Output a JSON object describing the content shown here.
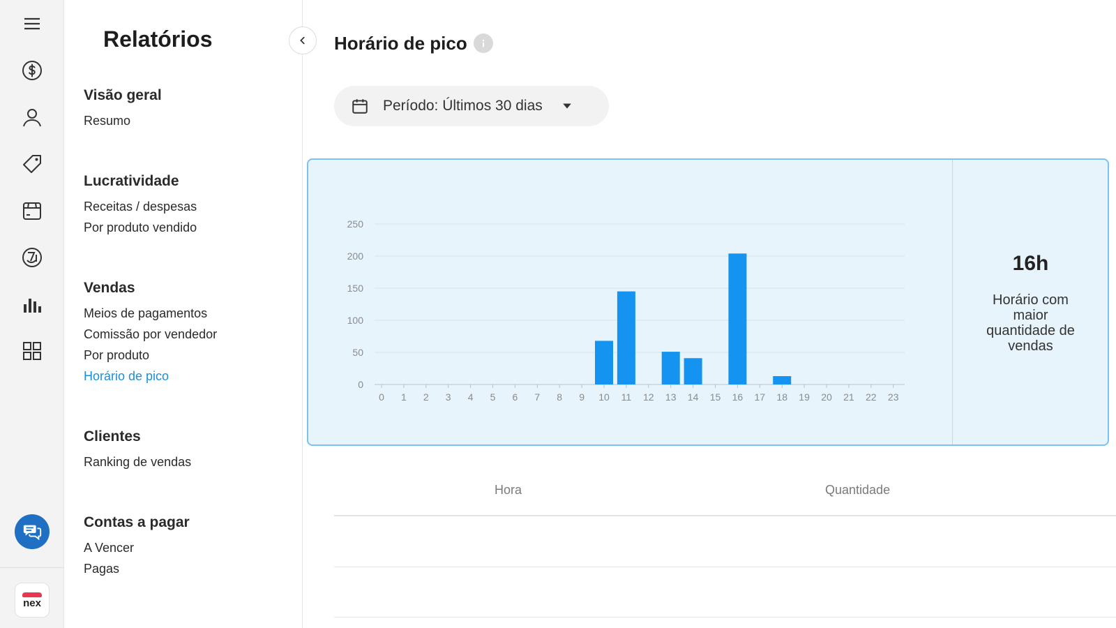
{
  "sidebar": {
    "title": "Relatórios",
    "sections": [
      {
        "title": "Visão geral",
        "items": [
          "Resumo"
        ]
      },
      {
        "title": "Lucratividade",
        "items": [
          "Receitas / despesas",
          "Por produto vendido"
        ]
      },
      {
        "title": "Vendas",
        "items": [
          "Meios de pagamentos",
          "Comissão por vendedor",
          "Por produto",
          "Horário de pico"
        ]
      },
      {
        "title": "Clientes",
        "items": [
          "Ranking de vendas"
        ]
      },
      {
        "title": "Contas a pagar",
        "items": [
          "A Vencer",
          "Pagas"
        ]
      }
    ],
    "active_item": "Horário de pico"
  },
  "rail": {
    "icons": [
      "menu-icon",
      "dollar-icon",
      "user-icon",
      "tag-icon",
      "box-icon",
      "dial-icon",
      "bar-chart-icon",
      "grid-icon"
    ],
    "chat_icon": "chat-icon",
    "logo_text": "nex"
  },
  "main": {
    "title": "Horário de pico",
    "period_label": "Período: Últimos 30 dias",
    "peak_value": "16h",
    "peak_label": "Horário com maior quantidade de vendas",
    "table_headers": [
      "Hora",
      "Quantidade"
    ]
  },
  "colors": {
    "accent": "#1a8fd6",
    "bar": "#1593f0",
    "card_bg": "#e8f4fc",
    "card_border": "#7cc2ee"
  },
  "chart_data": {
    "type": "bar",
    "categories": [
      "0",
      "1",
      "2",
      "3",
      "4",
      "5",
      "6",
      "7",
      "8",
      "9",
      "10",
      "11",
      "12",
      "13",
      "14",
      "15",
      "16",
      "17",
      "18",
      "19",
      "20",
      "21",
      "22",
      "23"
    ],
    "values": [
      0,
      0,
      0,
      0,
      0,
      0,
      0,
      0,
      0,
      0,
      68,
      145,
      0,
      51,
      41,
      0,
      204,
      0,
      13,
      0,
      0,
      0,
      0,
      0
    ],
    "yticks": [
      0,
      50,
      100,
      150,
      200,
      250
    ],
    "ylim": [
      0,
      250
    ],
    "grid": true
  }
}
